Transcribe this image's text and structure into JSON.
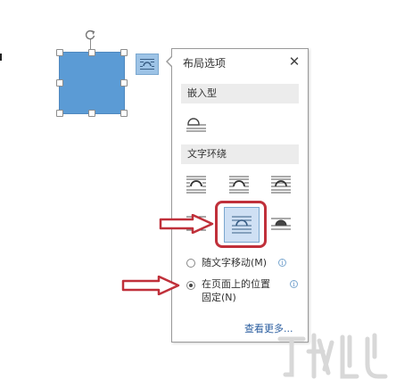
{
  "panel": {
    "title": "布局选项",
    "close_glyph": "✕",
    "section_inline": "嵌入型",
    "section_wrap": "文字环绕",
    "radio_move": "随文字移动(M)",
    "radio_fixed_line1": "在页面上的位置",
    "radio_fixed_line2": "固定(N)",
    "info_glyph": "i",
    "see_more": "查看更多..."
  },
  "state": {
    "selected_option": "wrap-row2-col2",
    "selected_radio": "fixed-on-page"
  },
  "colors": {
    "shape_fill": "#5b9bd5",
    "trigger_fill": "#9dc3e6",
    "selected_fill": "#cfe0f4",
    "arrow_red": "#c0303a",
    "link_blue": "#2a5d9f"
  },
  "icons": {
    "rotate": "rotate-handle-icon",
    "layout_options": "layout-options-icon",
    "close": "close-icon",
    "info": "info-icon",
    "arrow": "right-arrow-icon"
  }
}
